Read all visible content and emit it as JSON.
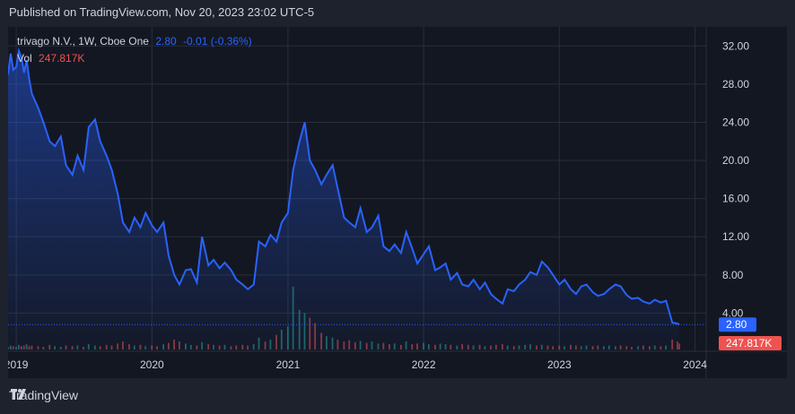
{
  "header": {
    "published": "Published on TradingView.com, Nov 20, 2023 23:02 UTC-5"
  },
  "legend": {
    "symbol": "trivago N.V., 1W, Cboe One",
    "price": "2.80",
    "change": "-0.01 (-0.36%)",
    "vol_label": "Vol",
    "vol_value": "247.817K"
  },
  "footer": {
    "brand": "TradingView"
  },
  "colors": {
    "line": "#2962ff",
    "up": "#26a69a",
    "down": "#ef5350",
    "grid": "#2a2e39",
    "text": "#d1d4dc"
  },
  "chart_data": {
    "type": "line",
    "title": "trivago N.V., 1W, Cboe One",
    "x": [
      "2018-12-10",
      "2018-12-17",
      "2018-12-24",
      "2019-01-01",
      "2019-01-08",
      "2019-01-15",
      "2019-01-22",
      "2019-01-29",
      "2019-02-05",
      "2019-02-12",
      "2019-03-01",
      "2019-03-15",
      "2019-04-01",
      "2019-04-15",
      "2019-05-01",
      "2019-05-15",
      "2019-06-01",
      "2019-06-15",
      "2019-07-01",
      "2019-07-15",
      "2019-08-01",
      "2019-08-15",
      "2019-09-01",
      "2019-09-15",
      "2019-10-01",
      "2019-10-15",
      "2019-11-01",
      "2019-11-15",
      "2019-12-01",
      "2019-12-15",
      "2020-01-01",
      "2020-01-15",
      "2020-02-01",
      "2020-02-15",
      "2020-03-01",
      "2020-03-15",
      "2020-04-01",
      "2020-04-15",
      "2020-05-01",
      "2020-05-15",
      "2020-06-01",
      "2020-06-15",
      "2020-07-01",
      "2020-07-15",
      "2020-08-01",
      "2020-08-15",
      "2020-09-01",
      "2020-09-15",
      "2020-10-01",
      "2020-10-15",
      "2020-11-01",
      "2020-11-15",
      "2020-12-01",
      "2020-12-15",
      "2021-01-01",
      "2021-01-15",
      "2021-02-01",
      "2021-02-15",
      "2021-03-01",
      "2021-03-15",
      "2021-04-01",
      "2021-04-15",
      "2021-05-01",
      "2021-05-15",
      "2021-06-01",
      "2021-06-15",
      "2021-07-01",
      "2021-07-15",
      "2021-08-01",
      "2021-08-15",
      "2021-09-01",
      "2021-09-15",
      "2021-10-01",
      "2021-10-15",
      "2021-11-01",
      "2021-11-15",
      "2021-12-01",
      "2021-12-15",
      "2022-01-01",
      "2022-01-15",
      "2022-02-01",
      "2022-02-15",
      "2022-03-01",
      "2022-03-15",
      "2022-04-01",
      "2022-04-15",
      "2022-05-01",
      "2022-05-15",
      "2022-06-01",
      "2022-06-15",
      "2022-07-01",
      "2022-07-15",
      "2022-08-01",
      "2022-08-15",
      "2022-09-01",
      "2022-09-15",
      "2022-10-01",
      "2022-10-15",
      "2022-11-01",
      "2022-11-15",
      "2022-12-01",
      "2022-12-15",
      "2023-01-01",
      "2023-01-15",
      "2023-02-01",
      "2023-02-15",
      "2023-03-01",
      "2023-03-15",
      "2023-04-01",
      "2023-04-15",
      "2023-05-01",
      "2023-05-15",
      "2023-06-01",
      "2023-06-15",
      "2023-07-01",
      "2023-07-15",
      "2023-08-01",
      "2023-08-15",
      "2023-09-01",
      "2023-09-15",
      "2023-10-01",
      "2023-10-15",
      "2023-11-01",
      "2023-11-15",
      "2023-11-20"
    ],
    "series": [
      {
        "values": [
          29.0,
          31.2,
          29.5,
          29.8,
          31.5,
          30.8,
          29.2,
          30.5,
          28.5,
          27.0,
          25.5,
          24.0,
          22.0,
          21.5,
          22.5,
          19.5,
          18.5,
          20.5,
          19.0,
          23.5,
          24.3,
          22.0,
          20.5,
          19.0,
          16.5,
          13.5,
          12.5,
          14.0,
          13.0,
          14.5,
          13.2,
          12.5,
          13.5,
          10.0,
          8.0,
          7.0,
          8.5,
          8.6,
          7.2,
          12.0,
          9.0,
          9.6,
          8.7,
          9.3,
          8.5,
          7.5,
          7.0,
          6.5,
          7.0,
          11.5,
          11.0,
          12.2,
          11.5,
          13.5,
          14.5,
          19.0,
          22.0,
          24.0,
          20.0,
          19.0,
          17.5,
          18.5,
          19.5,
          17.0,
          14.0,
          13.5,
          13.0,
          15.0,
          12.5,
          13.0,
          14.2,
          11.0,
          10.5,
          11.2,
          10.3,
          12.5,
          10.8,
          9.2,
          10.2,
          11.0,
          8.5,
          8.8,
          9.2,
          7.5,
          8.2,
          7.0,
          6.8,
          7.5,
          6.5,
          7.2,
          6.0,
          5.5,
          5.0,
          6.5,
          6.3,
          7.0,
          7.5,
          8.3,
          8.0,
          9.4,
          8.8,
          8.0,
          7.0,
          7.5,
          6.5,
          6.0,
          6.8,
          7.0,
          6.2,
          5.8,
          6.0,
          6.5,
          7.0,
          6.8,
          5.9,
          5.5,
          5.6,
          5.2,
          5.0,
          5.4,
          5.1,
          5.3,
          3.0,
          2.9,
          2.8
        ]
      }
    ],
    "xlim": [
      "2018-12-10",
      "2024-01-31"
    ],
    "ylim": [
      0,
      34
    ],
    "y_axis_ticks": [
      "32.00",
      "28.00",
      "24.00",
      "20.00",
      "16.00",
      "12.00",
      "8.00",
      "4.00"
    ],
    "y_tick_values": [
      32,
      28,
      24,
      20,
      16,
      12,
      8,
      4
    ],
    "x_axis_ticks": [
      "2019",
      "2020",
      "2021",
      "2022",
      "2023",
      "2024"
    ],
    "x_tick_dates": [
      "2019-01-01",
      "2020-01-01",
      "2021-01-01",
      "2022-01-01",
      "2023-01-01",
      "2024-01-01"
    ],
    "price_label": "2.80",
    "volume_label": "247.817K",
    "volume_series": [
      0.4,
      0.6,
      0.5,
      0.4,
      0.7,
      0.5,
      0.6,
      0.8,
      0.5,
      0.6,
      0.5,
      0.4,
      0.7,
      0.5,
      0.4,
      0.6,
      0.5,
      0.6,
      0.4,
      0.8,
      0.6,
      0.5,
      0.7,
      0.6,
      0.9,
      1.2,
      0.8,
      0.6,
      0.7,
      0.5,
      0.6,
      0.5,
      0.8,
      1.0,
      1.5,
      1.2,
      0.9,
      0.7,
      0.6,
      1.1,
      0.8,
      0.7,
      0.6,
      0.7,
      0.5,
      0.6,
      0.7,
      0.6,
      0.8,
      1.8,
      1.2,
      1.5,
      2.2,
      3.0,
      3.5,
      9.5,
      6.0,
      5.5,
      4.8,
      4.0,
      2.5,
      2.0,
      1.8,
      1.5,
      1.2,
      1.4,
      1.1,
      1.3,
      1.0,
      1.2,
      0.9,
      1.0,
      0.8,
      0.9,
      0.7,
      1.2,
      0.8,
      0.9,
      1.0,
      0.8,
      0.7,
      0.9,
      0.8,
      0.7,
      0.6,
      0.8,
      0.7,
      0.6,
      0.7,
      0.5,
      0.6,
      0.7,
      0.8,
      0.6,
      0.5,
      0.6,
      0.7,
      0.8,
      0.6,
      0.7,
      0.6,
      0.5,
      0.6,
      0.5,
      0.7,
      0.6,
      0.5,
      0.6,
      0.5,
      0.6,
      0.5,
      0.6,
      0.5,
      0.6,
      0.5,
      0.4,
      0.5,
      0.6,
      0.5,
      0.6,
      0.5,
      0.6,
      1.5,
      1.2,
      0.9
    ],
    "volume_up": [
      true,
      true,
      false,
      true,
      true,
      false,
      false,
      true,
      false,
      false,
      false,
      false,
      false,
      true,
      true,
      false,
      false,
      true,
      false,
      true,
      true,
      false,
      false,
      false,
      false,
      false,
      false,
      true,
      false,
      true,
      false,
      false,
      true,
      false,
      false,
      false,
      true,
      true,
      false,
      true,
      false,
      true,
      false,
      true,
      false,
      false,
      false,
      false,
      true,
      true,
      false,
      true,
      false,
      true,
      true,
      true,
      true,
      true,
      false,
      false,
      false,
      true,
      true,
      false,
      false,
      false,
      false,
      true,
      false,
      true,
      true,
      false,
      false,
      true,
      false,
      true,
      false,
      false,
      true,
      true,
      false,
      true,
      true,
      false,
      true,
      false,
      false,
      true,
      false,
      true,
      false,
      false,
      false,
      true,
      false,
      true,
      true,
      true,
      false,
      true,
      false,
      false,
      false,
      true,
      false,
      false,
      true,
      true,
      false,
      false,
      true,
      true,
      true,
      false,
      false,
      false,
      true,
      false,
      false,
      true,
      false,
      true,
      false,
      false,
      false
    ],
    "grid": true,
    "legend_position": "top-left"
  }
}
